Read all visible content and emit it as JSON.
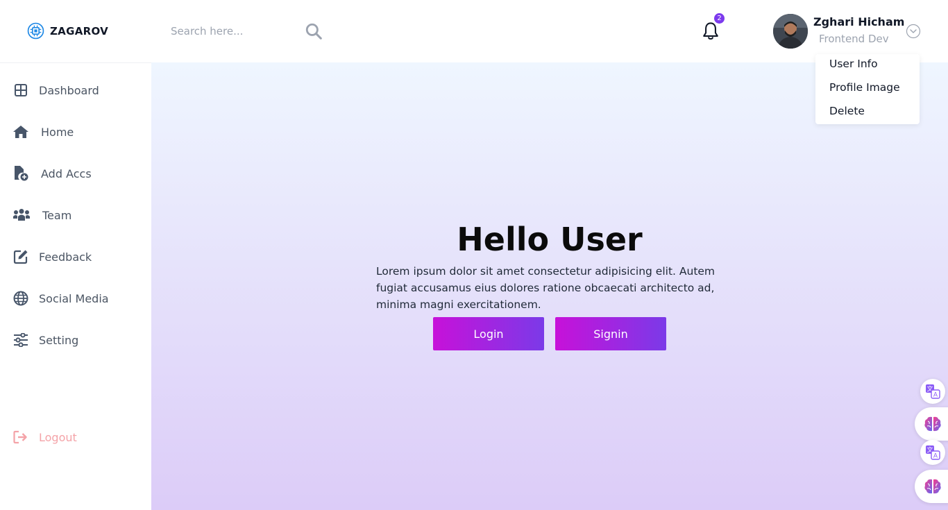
{
  "brand": {
    "name": "ZAGAROV",
    "icon": "chip-icon",
    "color": "#1e88e5"
  },
  "search": {
    "placeholder": "Search here...",
    "value": ""
  },
  "notifications": {
    "count": "2",
    "icon": "bell-icon"
  },
  "user": {
    "name": "Zghari Hicham",
    "role": "Frontend Dev"
  },
  "user_menu": {
    "items": [
      {
        "label": "User Info"
      },
      {
        "label": "Profile Image"
      },
      {
        "label": "Delete"
      }
    ]
  },
  "sidebar": {
    "items": [
      {
        "label": "Dashboard",
        "icon": "grid-icon"
      },
      {
        "label": "Home",
        "icon": "home-icon"
      },
      {
        "label": "Add Accs",
        "icon": "file-plus-icon"
      },
      {
        "label": "Team",
        "icon": "team-icon"
      },
      {
        "label": "Feedback",
        "icon": "edit-icon"
      },
      {
        "label": "Social Media",
        "icon": "globe-icon"
      },
      {
        "label": "Setting",
        "icon": "sliders-icon"
      }
    ],
    "logout": {
      "label": "Logout",
      "icon": "logout-icon"
    }
  },
  "hero": {
    "title": "Hello User",
    "text": "Lorem ipsum dolor sit amet consectetur adipisicing elit. Autem fugiat accusamus eius dolores ratione obcaecati architecto ad, minima magni exercitationem.",
    "login_label": "Login",
    "signin_label": "Signin"
  },
  "colors": {
    "accent_start": "#c711d9",
    "accent_end": "#7b3ae8",
    "logout": "#f4a3a8",
    "badge": "#7c3aed"
  }
}
